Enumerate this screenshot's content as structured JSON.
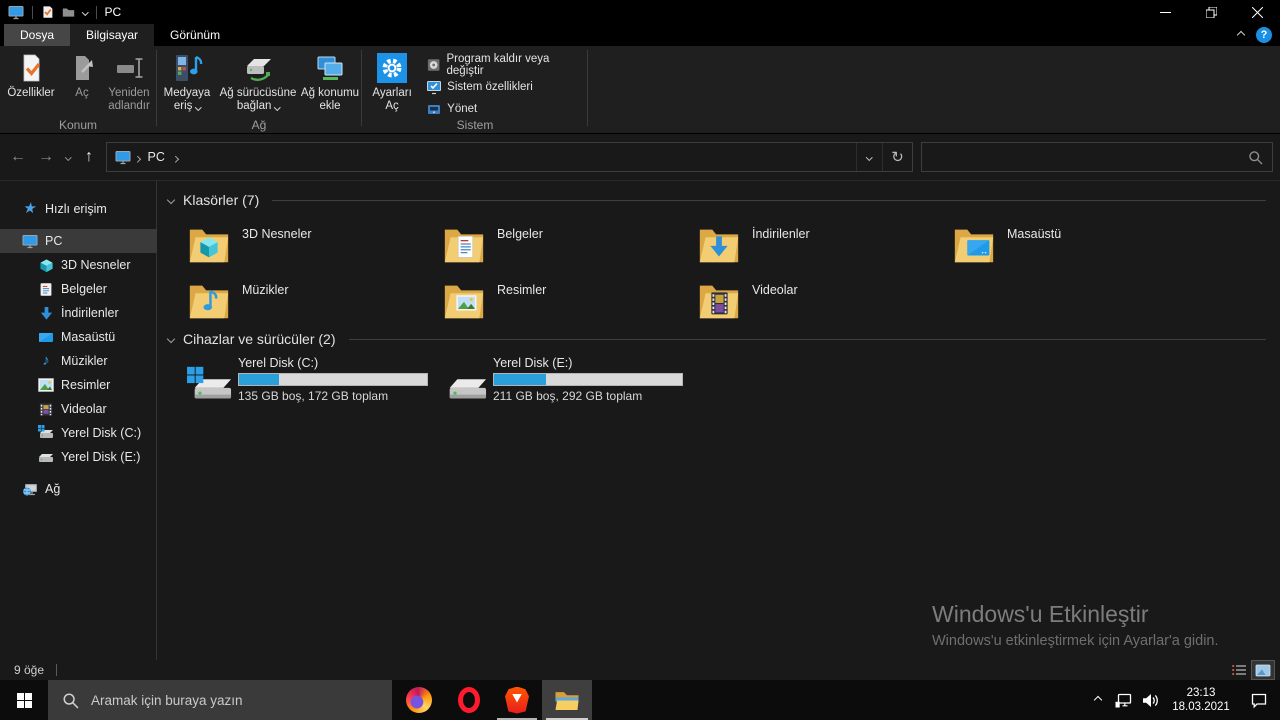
{
  "titlebar": {
    "title": "PC"
  },
  "icons": {
    "help": "?",
    "back": "←",
    "forward": "→",
    "up": "↑",
    "refresh": "↻"
  },
  "tabs": {
    "file": "Dosya",
    "computer": "Bilgisayar",
    "view": "Görünüm"
  },
  "ribbon": {
    "konum_label": "Konum",
    "ozellikler": "Özellikler",
    "ac": "Aç",
    "yeniden_adlandir": "Yeniden adlandır",
    "ag_label": "Ağ",
    "medyaya_eris": "Medyaya eriş",
    "ag_surucusune_baglan": "Ağ sürücüsüne bağlan",
    "ag_konumu_ekle": "Ağ konumu ekle",
    "sistem_label": "Sistem",
    "ayarlari_ac": "Ayarları Aç",
    "program_kaldir": "Program kaldır veya değiştir",
    "sistem_ozellikleri": "Sistem özellikleri",
    "yonet": "Yönet"
  },
  "addressbar": {
    "location": "PC"
  },
  "sidebar": {
    "items": [
      {
        "label": "Hızlı erişim"
      },
      {
        "label": "PC"
      },
      {
        "label": "3D Nesneler"
      },
      {
        "label": "Belgeler"
      },
      {
        "label": "İndirilenler"
      },
      {
        "label": "Masaüstü"
      },
      {
        "label": "Müzikler"
      },
      {
        "label": "Resimler"
      },
      {
        "label": "Videolar"
      },
      {
        "label": "Yerel Disk (C:)"
      },
      {
        "label": "Yerel Disk (E:)"
      },
      {
        "label": "Ağ"
      }
    ]
  },
  "main": {
    "folders_header": "Klasörler (7)",
    "folders": [
      {
        "name": "3D Nesneler"
      },
      {
        "name": "Belgeler"
      },
      {
        "name": "İndirilenler"
      },
      {
        "name": "Masaüstü"
      },
      {
        "name": "Müzikler"
      },
      {
        "name": "Resimler"
      },
      {
        "name": "Videolar"
      }
    ],
    "drives_header": "Cihazlar ve sürücüler (2)",
    "drives": [
      {
        "name": "Yerel Disk (C:)",
        "info": "135 GB boş, 172 GB toplam",
        "used_pct": 21.5
      },
      {
        "name": "Yerel Disk (E:)",
        "info": "211 GB boş, 292 GB toplam",
        "used_pct": 27.7
      }
    ],
    "watermark": {
      "title": "Windows'u Etkinleştir",
      "subtitle": "Windows'u etkinleştirmek için Ayarlar'a gidin."
    }
  },
  "statusbar": {
    "count": "9 öğe"
  },
  "taskbar": {
    "search_placeholder": "Aramak için buraya yazın",
    "clock": {
      "time": "23:13",
      "date": "18.03.2021"
    }
  }
}
